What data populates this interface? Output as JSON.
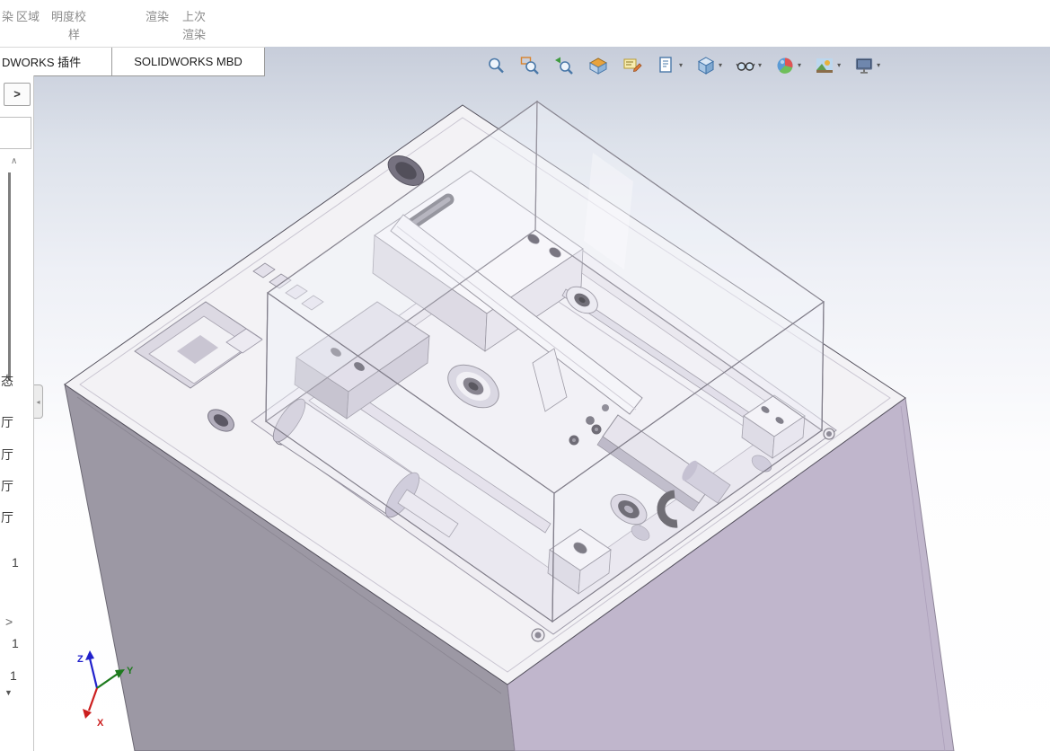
{
  "ribbon": {
    "cmd1": "染",
    "cmd2": "区域",
    "cmd3_line1": "明度校",
    "cmd3_line2": "样",
    "cmd4": "渲染",
    "cmd5_line1": "上次",
    "cmd5_line2": "渲染"
  },
  "tabs": {
    "addins": "DWORKS 插件",
    "mbd": "SOLIDWORKS MBD"
  },
  "headsup": {
    "caret": "▾",
    "items": [
      {
        "icon": "zoom-fit-icon",
        "dropdown": false
      },
      {
        "icon": "zoom-area-icon",
        "dropdown": false
      },
      {
        "icon": "previous-view-icon",
        "dropdown": false
      },
      {
        "icon": "section-view-icon",
        "dropdown": false
      },
      {
        "icon": "dynamic-annotation-icon",
        "dropdown": false
      },
      {
        "icon": "annotation-views-icon",
        "dropdown": true
      },
      {
        "icon": "view-orientation-icon",
        "dropdown": true
      },
      {
        "icon": "hide-show-items-icon",
        "dropdown": true
      },
      {
        "icon": "edit-appearance-icon",
        "dropdown": true
      },
      {
        "icon": "apply-scene-icon",
        "dropdown": true
      },
      {
        "icon": "view-settings-icon",
        "dropdown": true
      }
    ]
  },
  "left_panel": {
    "expand": ">",
    "scroll_up": "∧",
    "items": [
      "态",
      "厅",
      "厅",
      "厅",
      "厅",
      "1",
      ">",
      "1",
      "1"
    ],
    "scroll_down": "▼"
  },
  "triad": {
    "x": "X",
    "y": "Y",
    "z": "Z"
  },
  "colors": {
    "model_top": "#f3f2f5",
    "model_left": "#9c98a4",
    "model_right": "#c0b6cc",
    "axis_x": "#cc1f1f",
    "axis_y": "#1d7a1d",
    "axis_z": "#2020cc"
  }
}
